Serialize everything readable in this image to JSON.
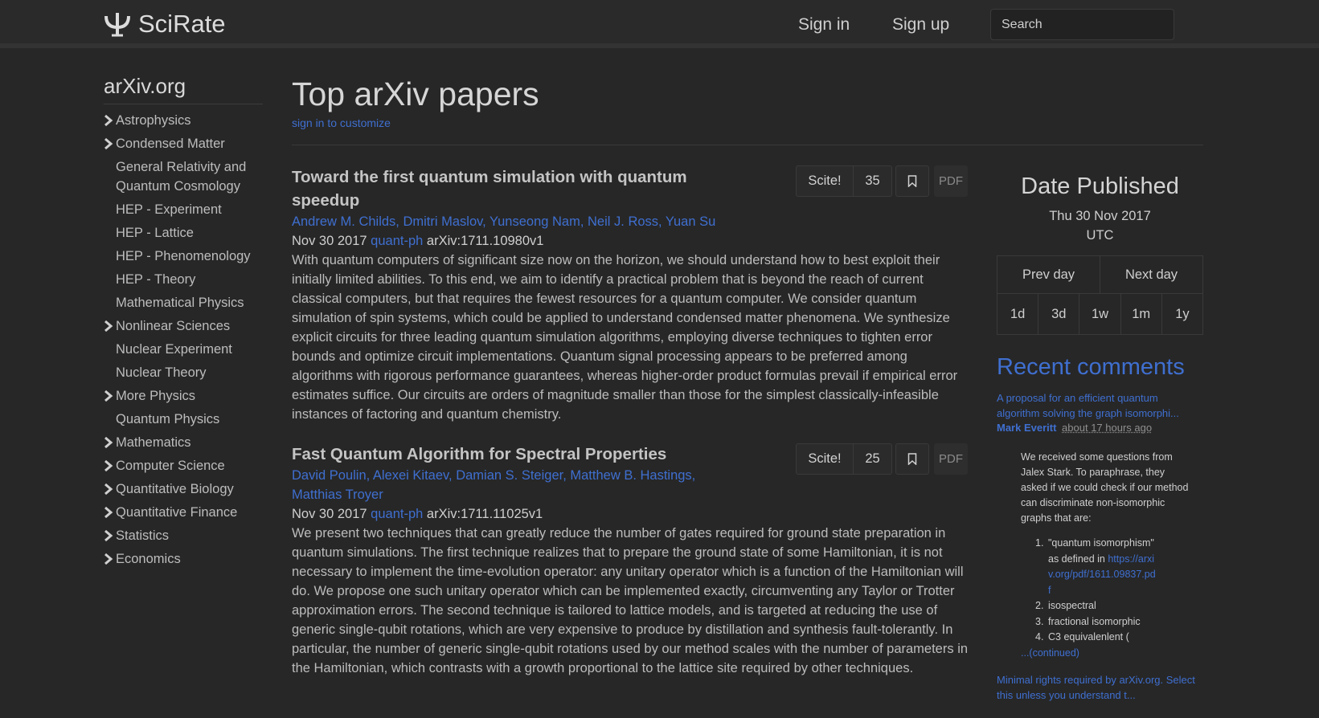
{
  "nav": {
    "brand": "SciRate",
    "sign_in": "Sign in",
    "sign_up": "Sign up",
    "search_placeholder": "Search"
  },
  "sidebar": {
    "title": "arXiv.org",
    "categories": [
      {
        "label": "Astrophysics",
        "expandable": true
      },
      {
        "label": "Condensed Matter",
        "expandable": true
      },
      {
        "label": "General Relativity and Quantum Cosmology",
        "expandable": false
      },
      {
        "label": "HEP - Experiment",
        "expandable": false
      },
      {
        "label": "HEP - Lattice",
        "expandable": false
      },
      {
        "label": "HEP - Phenomenology",
        "expandable": false
      },
      {
        "label": "HEP - Theory",
        "expandable": false
      },
      {
        "label": "Mathematical Physics",
        "expandable": false
      },
      {
        "label": "Nonlinear Sciences",
        "expandable": true
      },
      {
        "label": "Nuclear Experiment",
        "expandable": false
      },
      {
        "label": "Nuclear Theory",
        "expandable": false
      },
      {
        "label": "More Physics",
        "expandable": true
      },
      {
        "label": "Quantum Physics",
        "expandable": false
      },
      {
        "label": "Mathematics",
        "expandable": true
      },
      {
        "label": "Computer Science",
        "expandable": true
      },
      {
        "label": "Quantitative Biology",
        "expandable": true
      },
      {
        "label": "Quantitative Finance",
        "expandable": true
      },
      {
        "label": "Statistics",
        "expandable": true
      },
      {
        "label": "Economics",
        "expandable": true
      }
    ]
  },
  "main": {
    "title": "Top arXiv papers",
    "customize": "sign in to customize",
    "papers": [
      {
        "title": "Toward the first quantum simulation with quantum speedup",
        "authors": "Andrew M. Childs, Dmitri Maslov, Yunseong Nam, Neil J. Ross, Yuan Su",
        "date": "Nov 30 2017",
        "category": "quant-ph",
        "arxiv_id": "arXiv:1711.10980v1",
        "abstract": "With quantum computers of significant size now on the horizon, we should understand how to best exploit their initially limited abilities. To this end, we aim to identify a practical problem that is beyond the reach of current classical computers, but that requires the fewest resources for a quantum computer. We consider quantum simulation of spin systems, which could be applied to understand condensed matter phenomena. We synthesize explicit circuits for three leading quantum simulation algorithms, employing diverse techniques to tighten error bounds and optimize circuit implementations. Quantum signal processing appears to be preferred among algorithms with rigorous performance guarantees, whereas higher-order product formulas prevail if empirical error estimates suffice. Our circuits are orders of magnitude smaller than those for the simplest classically-infeasible instances of factoring and quantum chemistry.",
        "scite_label": "Scite!",
        "scite_count": "35",
        "pdf_label": "PDF"
      },
      {
        "title": "Fast Quantum Algorithm for Spectral Properties",
        "authors": "David Poulin, Alexei Kitaev, Damian S. Steiger, Matthew B. Hastings, Matthias Troyer",
        "date": "Nov 30 2017",
        "category": "quant-ph",
        "arxiv_id": "arXiv:1711.11025v1",
        "abstract": "We present two techniques that can greatly reduce the number of gates required for ground state preparation in quantum simulations. The first technique realizes that to prepare the ground state of some Hamiltonian, it is not necessary to implement the time-evolution operator: any unitary operator which is a function of the Hamiltonian will do. We propose one such unitary operator which can be implemented exactly, circumventing any Taylor or Trotter approximation errors. The second technique is tailored to lattice models, and is targeted at reducing the use of generic single-qubit rotations, which are very expensive to produce by distillation and synthesis fault-tolerantly. In particular, the number of generic single-qubit rotations used by our method scales with the number of parameters in the Hamiltonian, which contrasts with a growth proportional to the lattice site required by other techniques.",
        "scite_label": "Scite!",
        "scite_count": "25",
        "pdf_label": "PDF"
      }
    ]
  },
  "right": {
    "date_title": "Date Published",
    "date_line1": "Thu 30 Nov 2017",
    "date_line2": "UTC",
    "prev_day": "Prev day",
    "next_day": "Next day",
    "ranges": [
      "1d",
      "3d",
      "1w",
      "1m",
      "1y"
    ],
    "recent_title": "Recent comments",
    "comment1": {
      "paper": "A proposal for an efficient quantum algorithm solving the graph isomorphi...",
      "author": "Mark Everitt",
      "time": "about 17 hours ago",
      "body": "We received some questions from Jalex Stark. To paraphrase, they asked if we could check if our method can discriminate non-isomorphic graphs that are:",
      "items": [
        {
          "num": "1.",
          "text_before": "\"quantum isomorphism\" as defined in ",
          "link": "https://arxiv.org/pdf/1611.09837.pdf"
        },
        {
          "num": "2.",
          "text_before": "isospectral",
          "link": ""
        },
        {
          "num": "3.",
          "text_before": "fractional isomorphic",
          "link": ""
        },
        {
          "num": "4.",
          "text_before": "C3 equivalenlent (",
          "link": ""
        }
      ],
      "continued": "...(continued)"
    },
    "comment2_paper": "Minimal rights required by arXiv.org. Select this unless you understand t..."
  },
  "colors": {
    "background": "#272727",
    "link": "#3f6fd0",
    "navbar": "#2a2a2a"
  }
}
